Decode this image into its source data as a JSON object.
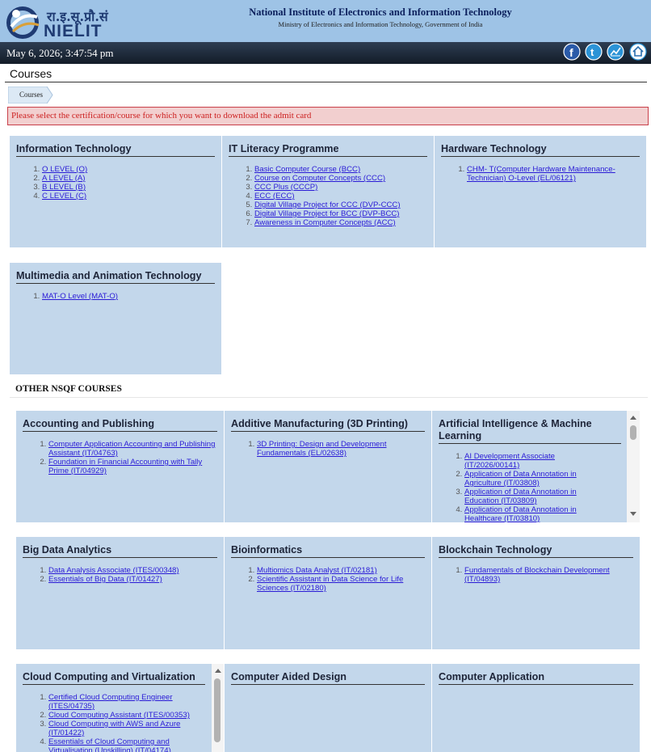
{
  "header": {
    "logo_hindi": "रा.इ.सू.प्रौ.सं",
    "logo_text": "NIELIT",
    "title": "National Institute of Electronics and Information Technology",
    "subtitle": "Ministry of Electronics and Information Technology, Government of India"
  },
  "datebar": {
    "datetime": "May 6, 2026; 3:47:54 pm",
    "icons": [
      "facebook-icon",
      "twitter-icon",
      "chart-icon",
      "home-icon"
    ]
  },
  "page": {
    "title": "Courses",
    "breadcrumb": "Courses",
    "alert": "Please select the certification/course for which you want to download the admit card",
    "other_section": "OTHER NSQF COURSES"
  },
  "categories": [
    {
      "title": "Information Technology",
      "items": [
        "O LEVEL (O)",
        "A LEVEL (A)",
        "B LEVEL (B)",
        "C LEVEL (C)"
      ]
    },
    {
      "title": "IT Literacy Programme",
      "items": [
        "Basic Computer Course (BCC)",
        "Course on Computer Concepts (CCC)",
        "CCC Plus (CCCP)",
        "ECC (ECC)",
        "Digital Village Project for CCC (DVP-CCC)",
        "Digital Village Project for BCC (DVP-BCC)",
        "Awareness in Computer Concepts (ACC)"
      ]
    },
    {
      "title": "Hardware Technology",
      "items": [
        "CHM- T(Computer Hardware Maintenance-Technician) O-Level (EL/06121)"
      ]
    },
    {
      "title": "Multimedia and Animation Technology",
      "items": [
        "MAT-O Level (MAT-O)"
      ]
    }
  ],
  "nsqf": [
    {
      "title": "Accounting and Publishing",
      "items": [
        "Computer Application Accounting and Publishing Assistant (IT/04763)",
        "Foundation in Financial Accounting with Tally Prime (IT/04929)"
      ]
    },
    {
      "title": "Additive Manufacturing (3D Printing)",
      "items": [
        "3D Printing: Design and Development Fundamentals (EL/02638)"
      ]
    },
    {
      "title": "Artificial Intelligence & Machine Learning",
      "items": [
        "AI Development Associate (IT/2026/00141)",
        "Application of Data Annotation in Agriculture (IT/03808)",
        "Application of Data Annotation in Education (IT/03809)",
        "Application of Data Annotation in Healthcare (IT/03810)"
      ]
    },
    {
      "title": "Big Data Analytics",
      "items": [
        "Data Analysis Associate (ITES/00348)",
        "Essentials of Big Data (IT/01427)"
      ]
    },
    {
      "title": "Bioinformatics",
      "items": [
        "Multiomics Data Analyst (IT/02181)",
        "Scientific Assistant in Data Science for Life Sciences (IT/02180)"
      ]
    },
    {
      "title": "Blockchain Technology",
      "items": [
        "Fundamentals of Blockchain Development (IT/04893)"
      ]
    },
    {
      "title": "Cloud Computing and Virtualization",
      "items": [
        "Certified Cloud Computing Engineer (ITES/04735)",
        "Cloud Computing Assistant (ITES/00353)",
        "Cloud Computing with AWS and Azure (IT/01422)",
        "Essentials of Cloud Computing and Virtualisation (Upskilling) (IT/04174)"
      ]
    },
    {
      "title": "Computer Aided Design",
      "items": []
    },
    {
      "title": "Computer Application",
      "items": []
    }
  ]
}
